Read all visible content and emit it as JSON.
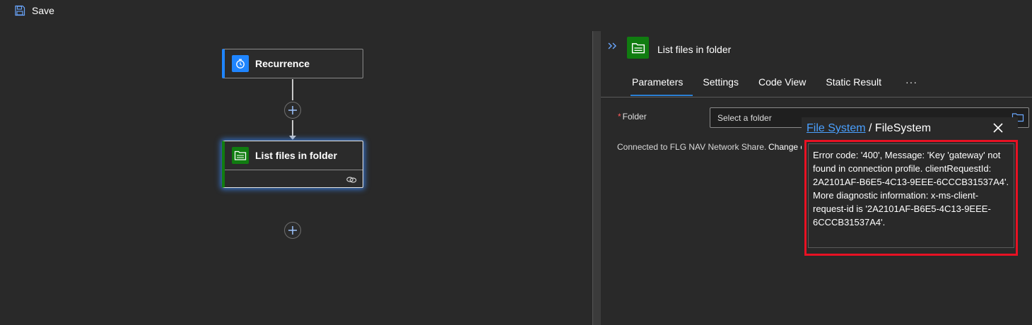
{
  "toolbar": {
    "save_label": "Save",
    "save_icon": "save-icon"
  },
  "canvas": {
    "nodes": [
      {
        "title": "Recurrence",
        "icon": "clock-icon",
        "accent": "#1f85ff"
      },
      {
        "title": "List files in folder",
        "icon": "folder-icon",
        "accent": "#107c10"
      }
    ]
  },
  "panel": {
    "title": "List files in folder",
    "expand_icon": "double-chevron-right-icon",
    "tabs": [
      "Parameters",
      "Settings",
      "Code View",
      "Static Result"
    ],
    "active_tab": "Parameters",
    "more_label": "···",
    "folder_label": "Folder",
    "required_marker": "*",
    "folder_placeholder": "Select a folder",
    "connected_text": "Connected to FLG NAV Network Share.",
    "change_link": "Change c"
  },
  "popup": {
    "link_text": "File System",
    "separator": " / ",
    "header_rest": "FileSystem",
    "error_message": "Error code: '400', Message: 'Key 'gateway' not found in connection profile. clientRequestId: 2A2101AF-B6E5-4C13-9EEE-6CCCB31537A4'. More diagnostic information: x-ms-client-request-id is '2A2101AF-B6E5-4C13-9EEE-6CCCB31537A4'."
  },
  "colors": {
    "background": "#292929",
    "accent_blue": "#1f85ff",
    "accent_green": "#107c10",
    "error_red": "#e81123",
    "link_blue": "#4aa0ff"
  }
}
